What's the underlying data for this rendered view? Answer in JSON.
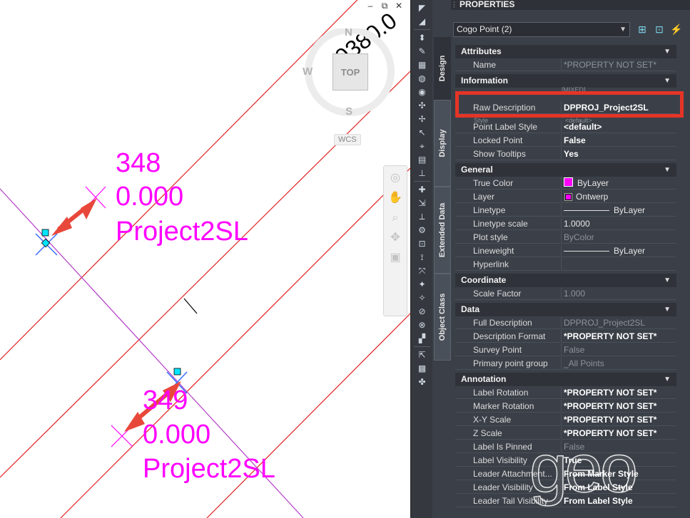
{
  "drawing": {
    "labels": [
      {
        "number": "348",
        "elevation": "0.000",
        "description": "Project2SL"
      },
      {
        "number": "349",
        "elevation": "0.000",
        "description": "Project2SL"
      }
    ],
    "coordinate_text": "0380.0",
    "viewcube": {
      "north": "N",
      "west": "W",
      "south": "S",
      "face": "TOP",
      "ucs": "WCS"
    }
  },
  "window_buttons": {
    "minimize": "–",
    "restore": "⧉",
    "close": "✕"
  },
  "properties": {
    "title": "PROPERTIES",
    "selection": "Cogo Point (2)",
    "tabs": [
      "Design",
      "Display",
      "Extended Data",
      "Object Class"
    ],
    "hidden_fragments": {
      "behind_highlight": "[MIXED]",
      "style_name": "Style",
      "style_value": "<default>"
    },
    "sections": [
      {
        "title": "Attributes",
        "rows": [
          {
            "name": "Name",
            "value": "*PROPERTY NOT SET*",
            "style": "dim"
          }
        ]
      },
      {
        "title": "Information",
        "rows": [
          {
            "name": "Raw Description",
            "value": "DPPROJ_Project2SL",
            "style": "bold"
          },
          {
            "name": "Point Label Style",
            "value": "<default>",
            "style": "bold"
          },
          {
            "name": "Locked Point",
            "value": "False",
            "style": "bold"
          },
          {
            "name": "Show Tooltips",
            "value": "Yes",
            "style": "bold"
          }
        ]
      },
      {
        "title": "General",
        "rows": [
          {
            "name": "True Color",
            "value": "ByLayer",
            "style": "norm"
          },
          {
            "name": "Layer",
            "value": "Ontwerp",
            "style": "norm"
          },
          {
            "name": "Linetype",
            "value": "ByLayer",
            "style": "norm"
          },
          {
            "name": "Linetype scale",
            "value": "1.0000",
            "style": "norm"
          },
          {
            "name": "Plot style",
            "value": "ByColor",
            "style": "dim"
          },
          {
            "name": "Lineweight",
            "value": "ByLayer",
            "style": "norm"
          },
          {
            "name": "Hyperlink",
            "value": "",
            "style": "norm"
          }
        ]
      },
      {
        "title": "Coordinate",
        "rows": [
          {
            "name": "Scale Factor",
            "value": "1.000",
            "style": "dim"
          }
        ]
      },
      {
        "title": "Data",
        "rows": [
          {
            "name": "Full Description",
            "value": "DPPROJ_Project2SL",
            "style": "dim"
          },
          {
            "name": "Description Format",
            "value": "*PROPERTY NOT SET*",
            "style": "bold"
          },
          {
            "name": "Survey Point",
            "value": "False",
            "style": "dim"
          },
          {
            "name": "Primary point group",
            "value": "_All Points",
            "style": "dim"
          }
        ]
      },
      {
        "title": "Annotation",
        "rows": [
          {
            "name": "Label Rotation",
            "value": "*PROPERTY NOT SET*",
            "style": "bold"
          },
          {
            "name": "Marker Rotation",
            "value": "*PROPERTY NOT SET*",
            "style": "bold"
          },
          {
            "name": "X-Y Scale",
            "value": "*PROPERTY NOT SET*",
            "style": "bold"
          },
          {
            "name": "Z Scale",
            "value": "*PROPERTY NOT SET*",
            "style": "bold"
          },
          {
            "name": "Label Is Pinned",
            "value": "False",
            "style": "dim"
          },
          {
            "name": "Label Visibility",
            "value": "True",
            "style": "bold"
          },
          {
            "name": "Leader Attachment...",
            "value": "From Marker Style",
            "style": "bold"
          },
          {
            "name": "Leader Visibility",
            "value": "From Label Style",
            "style": "bold"
          },
          {
            "name": "Leader Tail Visibility",
            "value": "From Label Style",
            "style": "bold"
          }
        ]
      }
    ]
  },
  "watermark": "geo",
  "colors": {
    "cad_label": "#ff00ff",
    "arrow": "#e8483a",
    "highlight": "#e53427",
    "grid_line": "#e02020",
    "panel_bg": "#3b4048"
  }
}
